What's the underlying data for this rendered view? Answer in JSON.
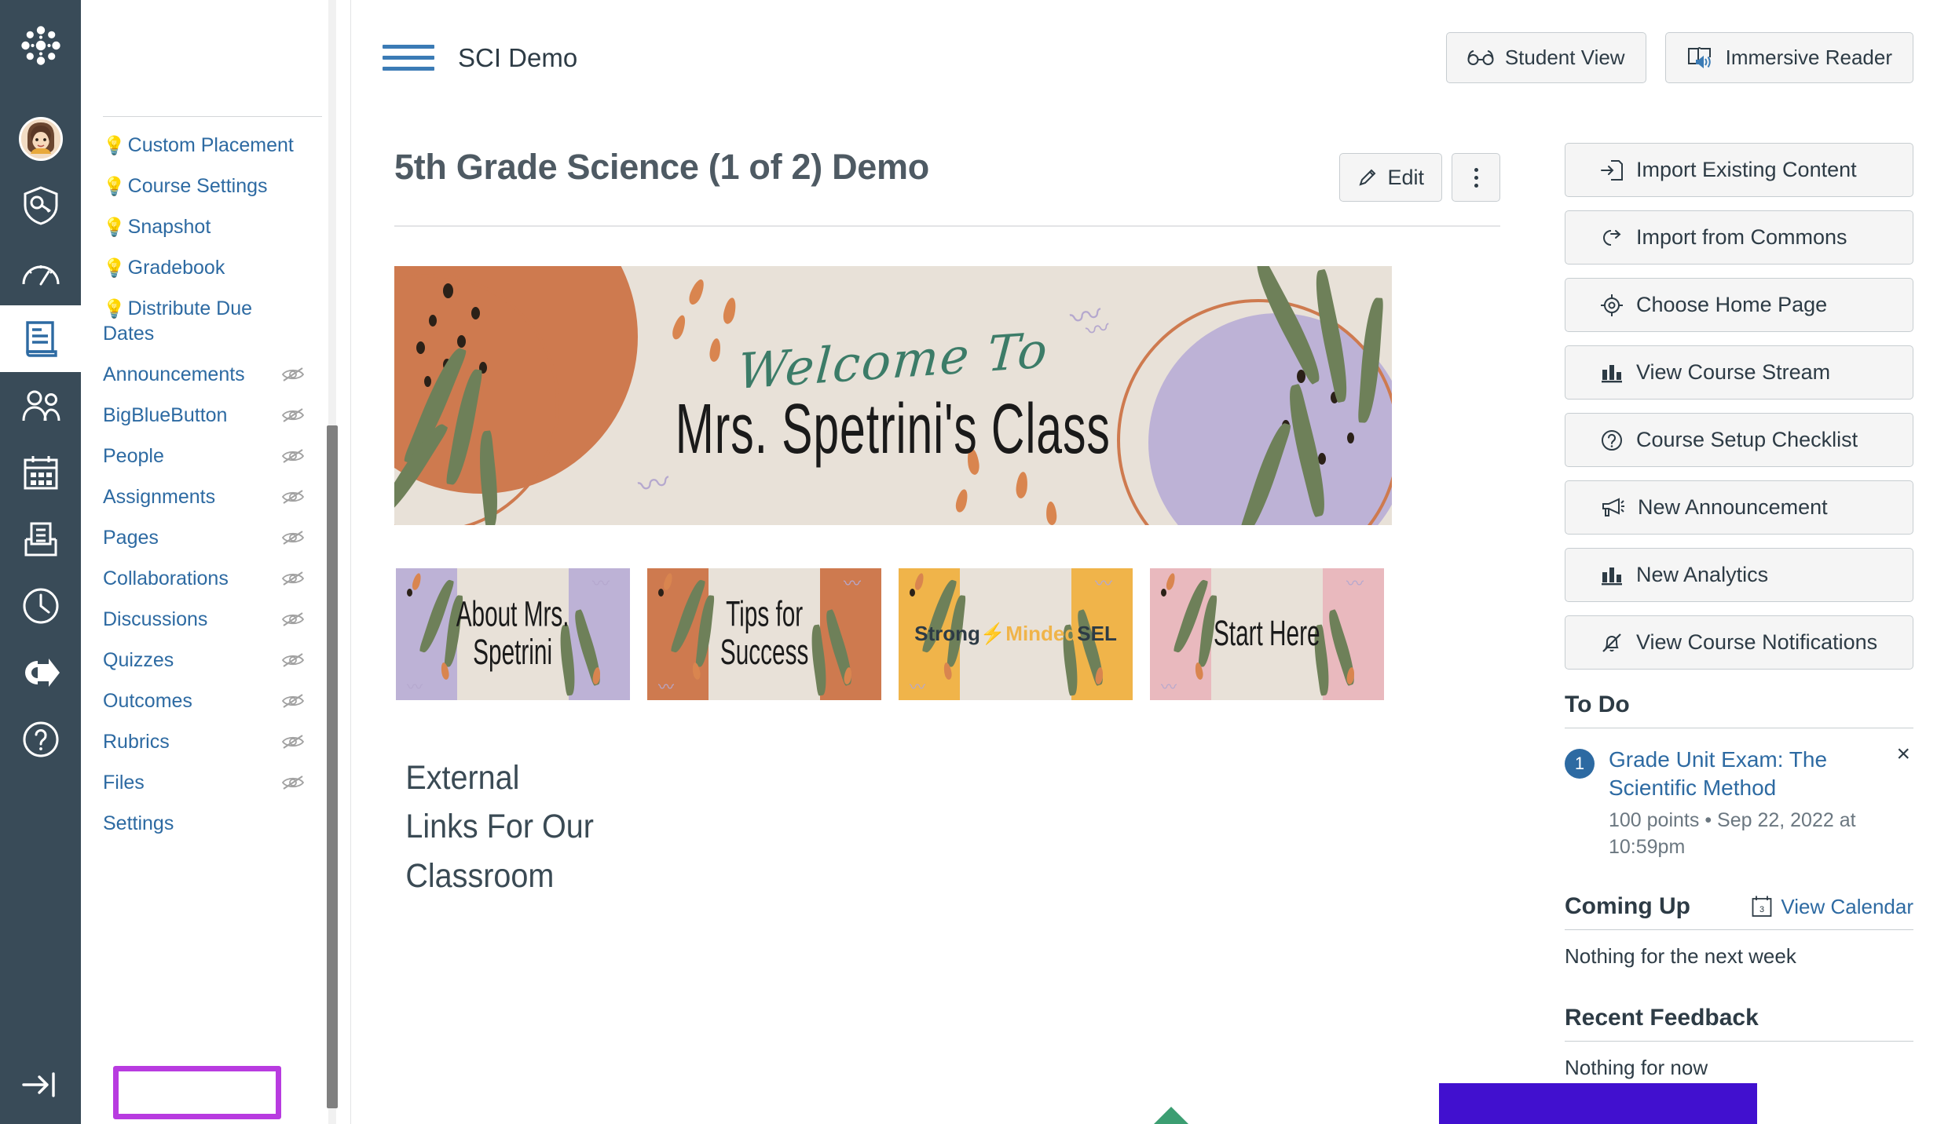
{
  "global_nav": {
    "logo": "canvas-logo",
    "items": [
      {
        "name": "account",
        "icon": "avatar-icon",
        "label": "Account"
      },
      {
        "name": "admin",
        "icon": "shield-key-icon",
        "label": "Admin"
      },
      {
        "name": "dashboard",
        "icon": "gauge-icon",
        "label": "Dashboard"
      },
      {
        "name": "courses",
        "icon": "book-icon",
        "label": "Courses",
        "active": true
      },
      {
        "name": "groups",
        "icon": "people-icon",
        "label": "Groups"
      },
      {
        "name": "calendar",
        "icon": "calendar-icon",
        "label": "Calendar"
      },
      {
        "name": "inbox",
        "icon": "inbox-icon",
        "label": "Inbox"
      },
      {
        "name": "history",
        "icon": "clock-icon",
        "label": "History"
      },
      {
        "name": "commons",
        "icon": "commons-arrow-icon",
        "label": "Commons"
      },
      {
        "name": "help",
        "icon": "question-circle-icon",
        "label": "Help"
      }
    ],
    "collapse_label": "Minimize Global Navigation"
  },
  "header": {
    "menu_label": "Course Navigation Menu",
    "course_title": "SCI Demo",
    "student_view_label": "Student View",
    "immersive_reader_label": "Immersive Reader"
  },
  "course_nav": {
    "items": [
      {
        "label": "Custom Placement",
        "bulb": true,
        "hidden_icon": false
      },
      {
        "label": "Course Settings",
        "bulb": true,
        "hidden_icon": false
      },
      {
        "label": "Snapshot",
        "bulb": true,
        "hidden_icon": false
      },
      {
        "label": "Gradebook",
        "bulb": true,
        "hidden_icon": false
      },
      {
        "label": "Distribute Due Dates",
        "bulb": true,
        "hidden_icon": false
      },
      {
        "label": "Announcements",
        "bulb": false,
        "hidden_icon": true
      },
      {
        "label": "BigBlueButton",
        "bulb": false,
        "hidden_icon": true
      },
      {
        "label": "People",
        "bulb": false,
        "hidden_icon": true
      },
      {
        "label": "Assignments",
        "bulb": false,
        "hidden_icon": true
      },
      {
        "label": "Pages",
        "bulb": false,
        "hidden_icon": true
      },
      {
        "label": "Collaborations",
        "bulb": false,
        "hidden_icon": true
      },
      {
        "label": "Discussions",
        "bulb": false,
        "hidden_icon": true
      },
      {
        "label": "Quizzes",
        "bulb": false,
        "hidden_icon": true
      },
      {
        "label": "Outcomes",
        "bulb": false,
        "hidden_icon": true
      },
      {
        "label": "Rubrics",
        "bulb": false,
        "hidden_icon": true
      },
      {
        "label": "Files",
        "bulb": false,
        "hidden_icon": true
      },
      {
        "label": "Settings",
        "bulb": false,
        "hidden_icon": false,
        "highlighted": true
      }
    ],
    "highlight_color": "#B83BE0"
  },
  "page": {
    "title": "5th Grade Science (1 of 2) Demo",
    "edit_label": "Edit",
    "more_label": "More options"
  },
  "banner": {
    "welcome_text": "Welcome To",
    "class_text": "Mrs. Spetrini's Class",
    "bg_color": "#E8E1D8",
    "accent_orange": "#CE7A4F",
    "accent_purple": "#BDB2D6",
    "accent_green": "#6E8059",
    "script_green": "#3C7C68"
  },
  "thumbnails": [
    {
      "label": "About Mrs.\nSpetrini",
      "accent_left": "#BDB2D6",
      "accent_right": "#BDB2D6"
    },
    {
      "label": "Tips for\nSuccess",
      "accent_left": "#CE7A4F",
      "accent_right": "#CE7A4F"
    },
    {
      "label": "Strong Minded SEL",
      "accent_left": "#F0B44A",
      "accent_right": "#F0B44A",
      "logo": true
    },
    {
      "label": "Start Here",
      "accent_left": "#E9B9BE",
      "accent_right": "#E9B9BE"
    }
  ],
  "sel_logo": {
    "word1": "Strong",
    "word2": "Minded",
    "word3": "SEL"
  },
  "body_heading": {
    "line1": "External",
    "line2": "Links For Our",
    "line3": "Classroom"
  },
  "sidebar": {
    "buttons": [
      {
        "label": "Import Existing Content",
        "icon": "import-content-icon"
      },
      {
        "label": "Import from Commons",
        "icon": "commons-icon"
      },
      {
        "label": "Choose Home Page",
        "icon": "target-icon"
      },
      {
        "label": "View Course Stream",
        "icon": "bar-chart-icon"
      },
      {
        "label": "Course Setup Checklist",
        "icon": "question-circle-icon"
      },
      {
        "label": "New Announcement",
        "icon": "megaphone-icon"
      },
      {
        "label": "New Analytics",
        "icon": "bar-chart-icon"
      },
      {
        "label": "View Course Notifications",
        "icon": "bell-muted-icon"
      }
    ],
    "todo": {
      "heading": "To Do",
      "items": [
        {
          "count": "1",
          "link": "Grade Unit Exam: The Scientific Method",
          "meta": "100 points • Sep 22, 2022 at 10:59pm",
          "dismiss": "×"
        }
      ]
    },
    "coming_up": {
      "heading": "Coming Up",
      "view_calendar_label": "View Calendar",
      "calendar_day": "3",
      "empty_text": "Nothing for the next week"
    },
    "recent_feedback": {
      "heading": "Recent Feedback",
      "empty_text": "Nothing for now"
    }
  },
  "colors": {
    "global_nav_bg": "#394B58",
    "link_blue": "#2D6AA2",
    "text_dark": "#2D3B45",
    "border_grey": "#C7CDD1",
    "purple_block": "#4110CF"
  }
}
